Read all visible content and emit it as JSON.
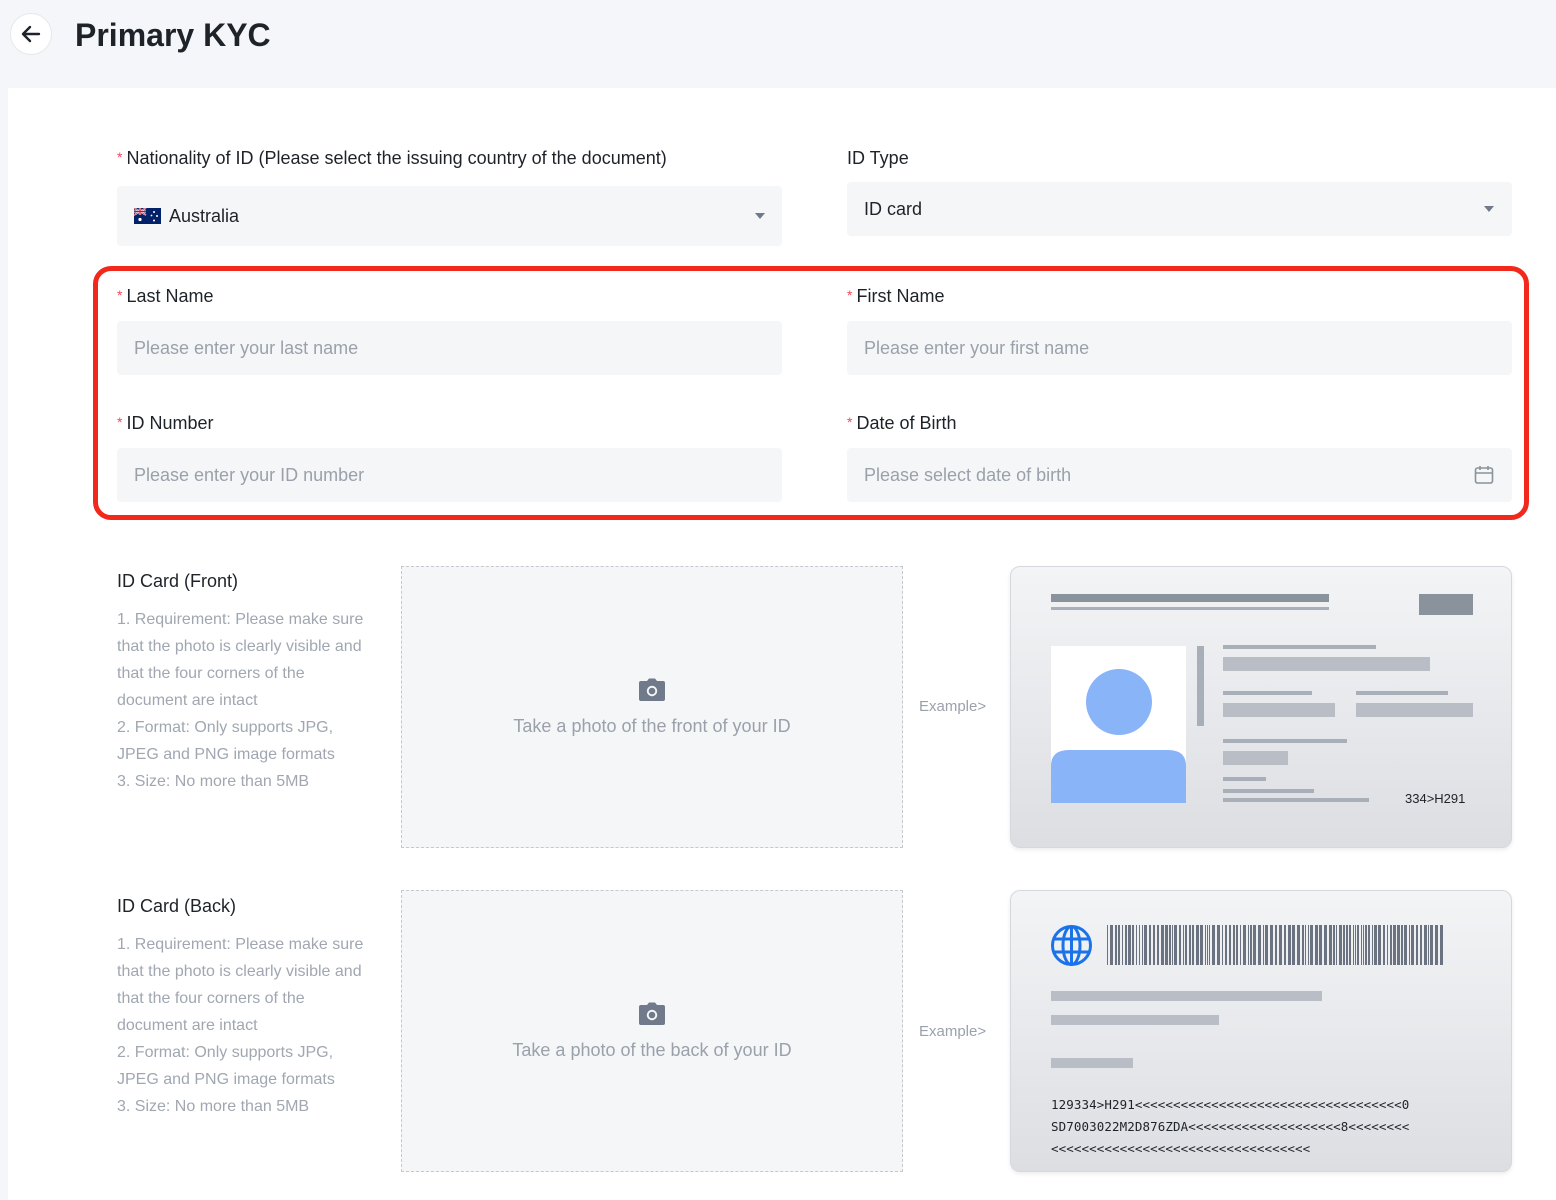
{
  "header": {
    "title": "Primary KYC"
  },
  "form": {
    "nationality": {
      "label": "Nationality of ID (Please select the issuing country of the document)",
      "value": "Australia"
    },
    "id_type": {
      "label": "ID Type",
      "value": "ID card"
    },
    "last_name": {
      "label": "Last Name",
      "placeholder": "Please enter your last name"
    },
    "first_name": {
      "label": "First Name",
      "placeholder": "Please enter your first name"
    },
    "id_number": {
      "label": "ID Number",
      "placeholder": "Please enter your ID number"
    },
    "dob": {
      "label": "Date of Birth",
      "placeholder": "Please select date of birth"
    },
    "required_mark": "*"
  },
  "front": {
    "title": "ID Card (Front)",
    "requirements": [
      "1. Requirement: Please make sure that the photo is clearly visible and that the four corners of the document are intact",
      "2. Format: Only supports JPG, JPEG and PNG image formats",
      "3. Size: No more than 5MB"
    ],
    "upload_text": "Take a photo of the front of your ID",
    "example_label": "Example>",
    "card_code": "334>H291"
  },
  "back": {
    "title": "ID Card (Back)",
    "requirements": [
      "1. Requirement: Please make sure that the photo is clearly visible and that the four corners of the document are intact",
      "2. Format: Only supports JPG, JPEG and PNG image formats",
      "3. Size: No more than 5MB"
    ],
    "upload_text": "Take a photo of the back of your ID",
    "example_label": "Example>",
    "mrz": [
      "129334>H291<<<<<<<<<<<<<<<<<<<<<<<<<<<<<<<<<<<0",
      "SD7003022M2D876ZDA<<<<<<<<<<<<<<<<<<<<8<<<<<<<<",
      "<<<<<<<<<<<<<<<<<<<<<<<<<<<<<<<<<<"
    ]
  },
  "colors": {
    "required": "#f6465d",
    "highlight": "#f2281c",
    "avatar": "#8ab4f8",
    "globe": "#1a73e8"
  },
  "icons": [
    "back-arrow-icon",
    "australia-flag-icon",
    "chevron-down-icon",
    "calendar-icon",
    "camera-icon",
    "globe-icon",
    "barcode-icon"
  ]
}
